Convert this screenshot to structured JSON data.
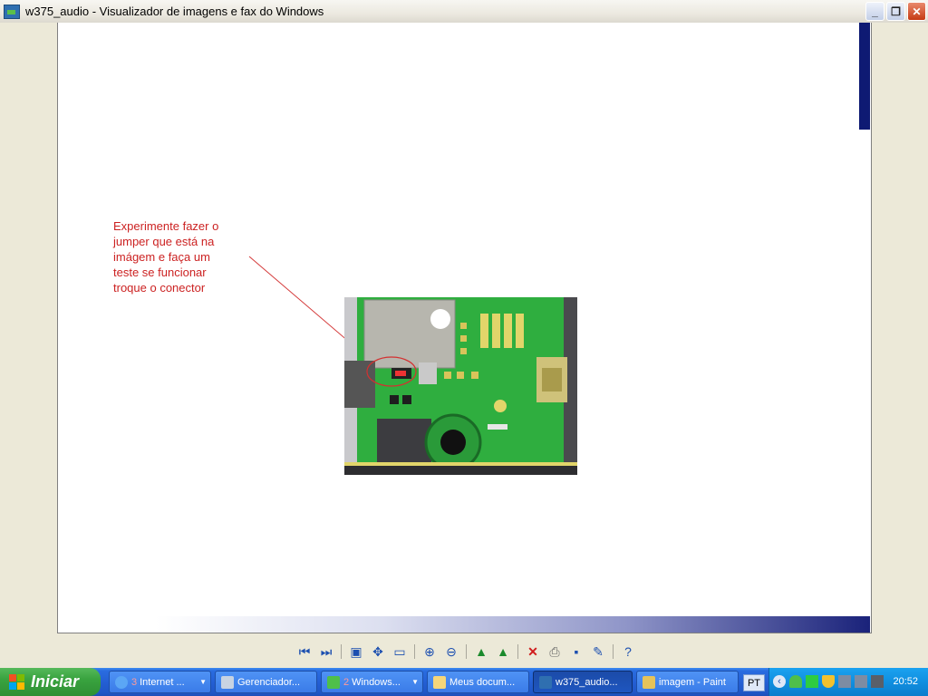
{
  "window": {
    "title": "w375_audio - Visualizador de imagens e fax do Windows",
    "buttons": [
      "minimize",
      "restore",
      "close"
    ]
  },
  "image_content": {
    "note_lines": [
      "Experimente fazer o",
      "jumper que está na",
      "imágem e faça um",
      "teste se funcionar",
      "troque o conector"
    ],
    "colors": {
      "note": "#cc2222",
      "page_strip": "#0e1a73"
    }
  },
  "toolbar": {
    "groups": [
      [
        "previous-image-icon",
        "next-image-icon"
      ],
      [
        "best-fit-icon",
        "actual-size-icon",
        "slideshow-icon"
      ],
      [
        "zoom-in-icon",
        "zoom-out-icon"
      ],
      [
        "rotate-clockwise-icon",
        "rotate-counterclockwise-icon"
      ],
      [
        "delete-icon",
        "print-icon",
        "save-icon",
        "edit-icon"
      ],
      [
        "help-icon"
      ]
    ]
  },
  "taskbar": {
    "start_label": "Iniciar",
    "tasks": [
      {
        "count": "3",
        "label": "Internet ...",
        "grouped": true
      },
      {
        "count": "",
        "label": "Gerenciador...",
        "grouped": false
      },
      {
        "count": "2",
        "label": "Windows...",
        "grouped": true
      },
      {
        "count": "",
        "label": "Meus docum...",
        "grouped": false
      },
      {
        "count": "",
        "label": "w375_audio...",
        "grouped": false,
        "active": true
      },
      {
        "count": "",
        "label": "imagem - Paint",
        "grouped": false
      }
    ],
    "language": "PT",
    "clock": "20:52"
  }
}
